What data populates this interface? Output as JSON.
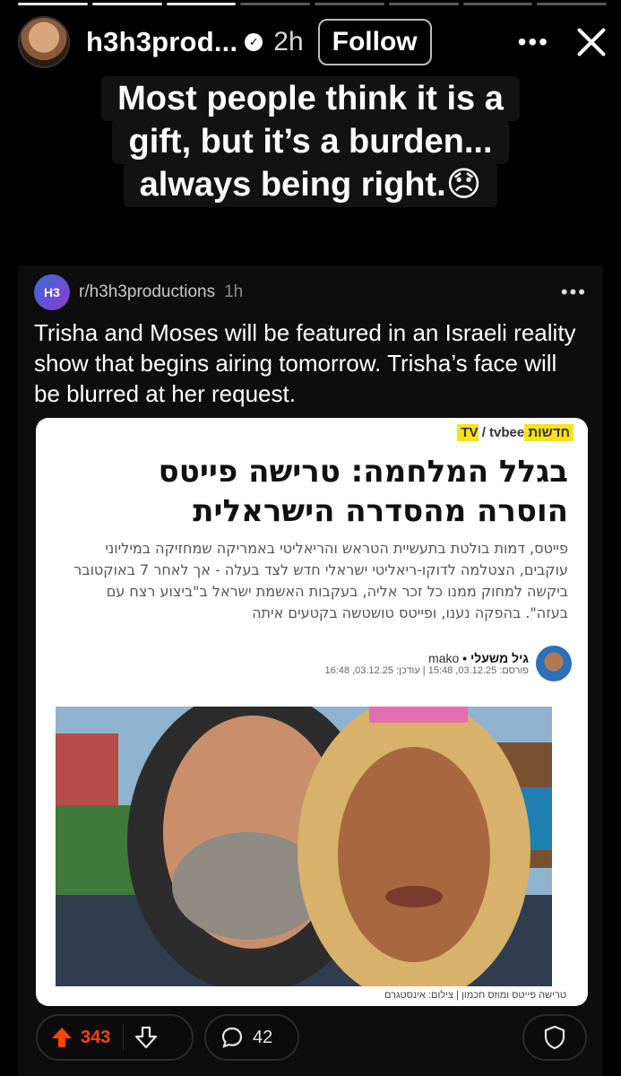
{
  "story": {
    "username": "h3h3prod...",
    "time": "2h",
    "follow_label": "Follow",
    "segments_total": 8,
    "segments_done": 3
  },
  "caption": {
    "lines": [
      "Most people think it is a",
      "gift, but it’s a burden...",
      "always being right.😞"
    ]
  },
  "post": {
    "subreddit_icon": "H3",
    "subreddit": "r/h3h3productions",
    "time": "1h",
    "text": "Trisha and Moses will be featured in an Israeli reality show that begins airing tomorrow. Trisha’s face will be blurred at her request.",
    "upvotes": "343",
    "comments": "42"
  },
  "article": {
    "source": "tvbee",
    "source_tag": "חדשות TV",
    "headline": "בגלל המלחמה: טרישה פייטס הוסרה מהסדרה הישראלית",
    "lead": "פייטס, דמות בולטת בתעשיית הטראש והריאליטי באמריקה שמחזיקה במיליוני עוקבים, הצטלמה לדוקו-ריאליטי ישראלי חדש לצד בעלה - אך לאחר 7 באוקטובר ביקשה למחוק ממנו כל זכר אליה, בעקבות האשמת ישראל ב\"ביצוע רצח עם בעזה\". בהפקה נענו, ופייטס טושטשה בקטעים איתה",
    "author": "גיל משעלי",
    "outlet": "mako",
    "dates": "פורסם: 03.12.25, 15:48 | עודכן: 03.12.25, 16:48",
    "photo_caption": "טרישה פייטס ומוזס חכמון | צילום: אינסטגרם"
  }
}
